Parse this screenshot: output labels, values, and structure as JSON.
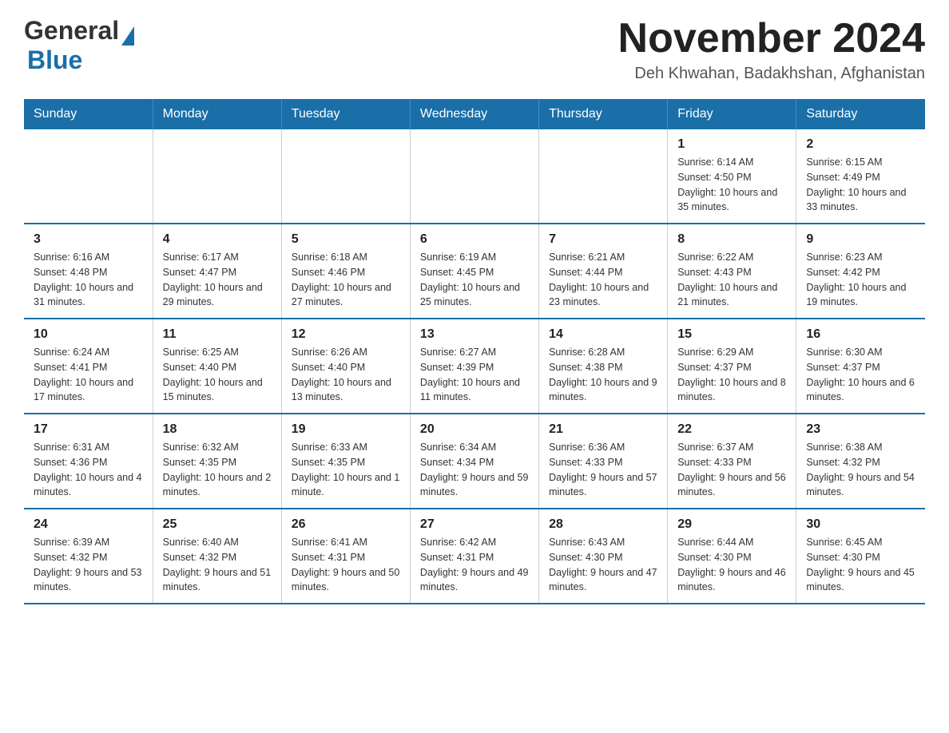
{
  "header": {
    "logo_general": "General",
    "logo_blue": "Blue",
    "month_title": "November 2024",
    "location": "Deh Khwahan, Badakhshan, Afghanistan"
  },
  "days_of_week": [
    "Sunday",
    "Monday",
    "Tuesday",
    "Wednesday",
    "Thursday",
    "Friday",
    "Saturday"
  ],
  "weeks": [
    [
      {
        "day": "",
        "info": ""
      },
      {
        "day": "",
        "info": ""
      },
      {
        "day": "",
        "info": ""
      },
      {
        "day": "",
        "info": ""
      },
      {
        "day": "",
        "info": ""
      },
      {
        "day": "1",
        "info": "Sunrise: 6:14 AM\nSunset: 4:50 PM\nDaylight: 10 hours and 35 minutes."
      },
      {
        "day": "2",
        "info": "Sunrise: 6:15 AM\nSunset: 4:49 PM\nDaylight: 10 hours and 33 minutes."
      }
    ],
    [
      {
        "day": "3",
        "info": "Sunrise: 6:16 AM\nSunset: 4:48 PM\nDaylight: 10 hours and 31 minutes."
      },
      {
        "day": "4",
        "info": "Sunrise: 6:17 AM\nSunset: 4:47 PM\nDaylight: 10 hours and 29 minutes."
      },
      {
        "day": "5",
        "info": "Sunrise: 6:18 AM\nSunset: 4:46 PM\nDaylight: 10 hours and 27 minutes."
      },
      {
        "day": "6",
        "info": "Sunrise: 6:19 AM\nSunset: 4:45 PM\nDaylight: 10 hours and 25 minutes."
      },
      {
        "day": "7",
        "info": "Sunrise: 6:21 AM\nSunset: 4:44 PM\nDaylight: 10 hours and 23 minutes."
      },
      {
        "day": "8",
        "info": "Sunrise: 6:22 AM\nSunset: 4:43 PM\nDaylight: 10 hours and 21 minutes."
      },
      {
        "day": "9",
        "info": "Sunrise: 6:23 AM\nSunset: 4:42 PM\nDaylight: 10 hours and 19 minutes."
      }
    ],
    [
      {
        "day": "10",
        "info": "Sunrise: 6:24 AM\nSunset: 4:41 PM\nDaylight: 10 hours and 17 minutes."
      },
      {
        "day": "11",
        "info": "Sunrise: 6:25 AM\nSunset: 4:40 PM\nDaylight: 10 hours and 15 minutes."
      },
      {
        "day": "12",
        "info": "Sunrise: 6:26 AM\nSunset: 4:40 PM\nDaylight: 10 hours and 13 minutes."
      },
      {
        "day": "13",
        "info": "Sunrise: 6:27 AM\nSunset: 4:39 PM\nDaylight: 10 hours and 11 minutes."
      },
      {
        "day": "14",
        "info": "Sunrise: 6:28 AM\nSunset: 4:38 PM\nDaylight: 10 hours and 9 minutes."
      },
      {
        "day": "15",
        "info": "Sunrise: 6:29 AM\nSunset: 4:37 PM\nDaylight: 10 hours and 8 minutes."
      },
      {
        "day": "16",
        "info": "Sunrise: 6:30 AM\nSunset: 4:37 PM\nDaylight: 10 hours and 6 minutes."
      }
    ],
    [
      {
        "day": "17",
        "info": "Sunrise: 6:31 AM\nSunset: 4:36 PM\nDaylight: 10 hours and 4 minutes."
      },
      {
        "day": "18",
        "info": "Sunrise: 6:32 AM\nSunset: 4:35 PM\nDaylight: 10 hours and 2 minutes."
      },
      {
        "day": "19",
        "info": "Sunrise: 6:33 AM\nSunset: 4:35 PM\nDaylight: 10 hours and 1 minute."
      },
      {
        "day": "20",
        "info": "Sunrise: 6:34 AM\nSunset: 4:34 PM\nDaylight: 9 hours and 59 minutes."
      },
      {
        "day": "21",
        "info": "Sunrise: 6:36 AM\nSunset: 4:33 PM\nDaylight: 9 hours and 57 minutes."
      },
      {
        "day": "22",
        "info": "Sunrise: 6:37 AM\nSunset: 4:33 PM\nDaylight: 9 hours and 56 minutes."
      },
      {
        "day": "23",
        "info": "Sunrise: 6:38 AM\nSunset: 4:32 PM\nDaylight: 9 hours and 54 minutes."
      }
    ],
    [
      {
        "day": "24",
        "info": "Sunrise: 6:39 AM\nSunset: 4:32 PM\nDaylight: 9 hours and 53 minutes."
      },
      {
        "day": "25",
        "info": "Sunrise: 6:40 AM\nSunset: 4:32 PM\nDaylight: 9 hours and 51 minutes."
      },
      {
        "day": "26",
        "info": "Sunrise: 6:41 AM\nSunset: 4:31 PM\nDaylight: 9 hours and 50 minutes."
      },
      {
        "day": "27",
        "info": "Sunrise: 6:42 AM\nSunset: 4:31 PM\nDaylight: 9 hours and 49 minutes."
      },
      {
        "day": "28",
        "info": "Sunrise: 6:43 AM\nSunset: 4:30 PM\nDaylight: 9 hours and 47 minutes."
      },
      {
        "day": "29",
        "info": "Sunrise: 6:44 AM\nSunset: 4:30 PM\nDaylight: 9 hours and 46 minutes."
      },
      {
        "day": "30",
        "info": "Sunrise: 6:45 AM\nSunset: 4:30 PM\nDaylight: 9 hours and 45 minutes."
      }
    ]
  ]
}
